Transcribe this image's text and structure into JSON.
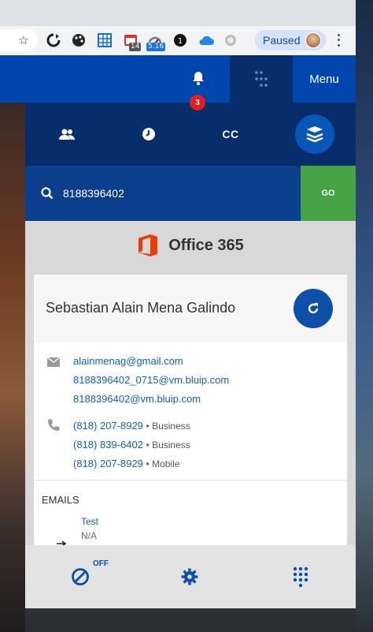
{
  "browser": {
    "extension_badges": [
      "14",
      "5.16",
      "1"
    ],
    "profile_label": "Paused"
  },
  "header": {
    "notification_count": "3",
    "menu_label": "Menu"
  },
  "nav": {
    "items": [
      {
        "name": "contacts",
        "icon": "contacts-icon"
      },
      {
        "name": "history",
        "icon": "clock-icon"
      },
      {
        "name": "cc",
        "label": "CC"
      },
      {
        "name": "integrations",
        "icon": "stack-icon",
        "active": true
      }
    ]
  },
  "search": {
    "value": "8188396402",
    "go_label": "GO"
  },
  "integration": {
    "name": "Office 365"
  },
  "contact": {
    "name": "Sebastian Alain Mena Galindo",
    "emails": [
      "alainmenag@gmail.com",
      "8188396402_0715@vm.bluip.com",
      "8188396402@vm.bluip.com"
    ],
    "phones": [
      {
        "number": "(818) 207-8929",
        "type": "• Business"
      },
      {
        "number": "(818) 839-6402",
        "type": "• Business"
      },
      {
        "number": "(818) 207-8929",
        "type": "• Mobile"
      }
    ]
  },
  "emails_section": {
    "heading": "EMAILS",
    "items": [
      {
        "title": "Test",
        "subtitle": "N/A"
      }
    ]
  },
  "footer": {
    "dnd_state": "OFF"
  },
  "colors": {
    "header_blue": "#0046ad",
    "nav_dark": "#072e6b",
    "search_blue": "#0a3f8c",
    "go_green": "#46a447",
    "link_blue": "#1060b8",
    "badge_red": "#e11d1d",
    "office_orange": "#eb3c00"
  }
}
